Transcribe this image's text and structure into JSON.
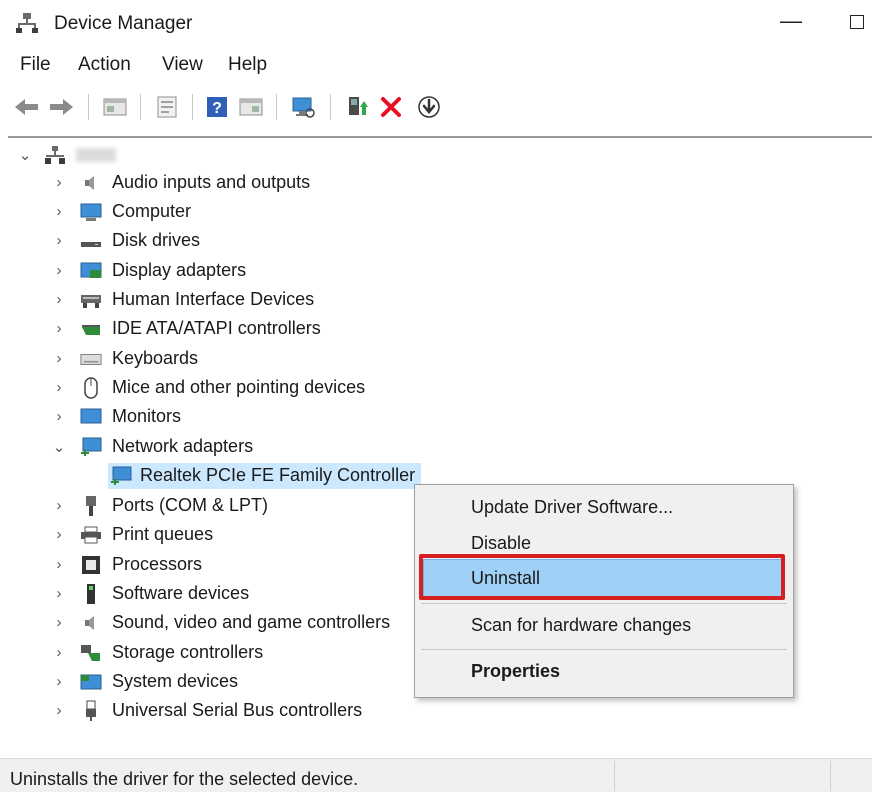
{
  "window": {
    "title": "Device Manager",
    "minimize_glyph": "—"
  },
  "menu": [
    "File",
    "Action",
    "View",
    "Help"
  ],
  "toolbar": {
    "icons": [
      "back-arrow-icon",
      "forward-arrow-icon",
      "properties-pane-icon",
      "show-hidden-icon",
      "help-icon",
      "action-pane-icon",
      "monitor-scan-icon",
      "add-driver-icon",
      "uninstall-x-icon",
      "update-driver-icon"
    ]
  },
  "tree": {
    "root_label": "",
    "items": [
      {
        "label": "Audio inputs and outputs",
        "icon": "speaker-icon"
      },
      {
        "label": "Computer",
        "icon": "computer-icon"
      },
      {
        "label": "Disk drives",
        "icon": "disk-drive-icon"
      },
      {
        "label": "Display adapters",
        "icon": "display-adapter-icon"
      },
      {
        "label": "Human Interface Devices",
        "icon": "hid-icon"
      },
      {
        "label": "IDE ATA/ATAPI controllers",
        "icon": "ide-controller-icon"
      },
      {
        "label": "Keyboards",
        "icon": "keyboard-icon"
      },
      {
        "label": "Mice and other pointing devices",
        "icon": "mouse-icon"
      },
      {
        "label": "Monitors",
        "icon": "monitor-icon"
      },
      {
        "label": "Network adapters",
        "icon": "network-adapter-icon",
        "expanded": true
      },
      {
        "label": "Ports (COM & LPT)",
        "icon": "port-icon"
      },
      {
        "label": "Print queues",
        "icon": "printer-icon"
      },
      {
        "label": "Processors",
        "icon": "processor-icon"
      },
      {
        "label": "Software devices",
        "icon": "software-device-icon"
      },
      {
        "label": "Sound, video and game controllers",
        "icon": "sound-controller-icon"
      },
      {
        "label": "Storage controllers",
        "icon": "storage-controller-icon"
      },
      {
        "label": "System devices",
        "icon": "system-device-icon"
      },
      {
        "label": "Universal Serial Bus controllers",
        "icon": "usb-icon"
      }
    ],
    "network_child": {
      "label": "Realtek PCIe FE Family Controller",
      "icon": "network-adapter-icon"
    }
  },
  "context_menu": {
    "items": [
      "Update Driver Software...",
      "Disable",
      "Uninstall",
      "Scan for hardware changes",
      "Properties"
    ],
    "highlighted": "Uninstall"
  },
  "status_bar": {
    "text": "Uninstalls the driver for the selected device."
  },
  "colors": {
    "selection": "#cce8ff",
    "menu_highlight": "#9fd0f6",
    "callout_outline": "#d62020",
    "uninstall_x": "#e81123"
  }
}
